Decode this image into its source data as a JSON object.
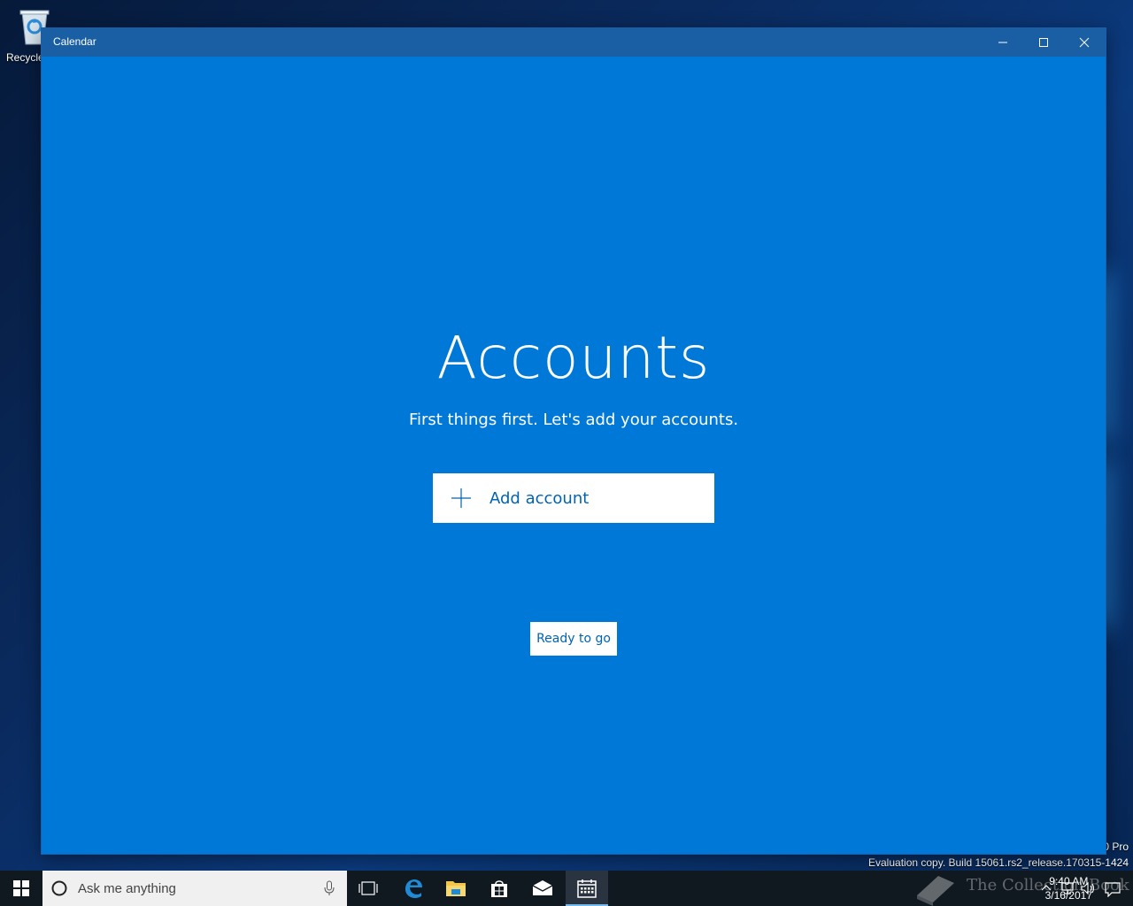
{
  "desktop": {
    "recycle_bin_label": "Recycle",
    "watermark": {
      "line1": "0 Pro",
      "line2": "Evaluation copy. Build 15061.rs2_release.170315-1424"
    }
  },
  "window": {
    "title": "Calendar",
    "controls": [
      "minimize",
      "maximize",
      "close"
    ]
  },
  "accounts_page": {
    "heading": "Accounts",
    "subtitle": "First things first. Let's add your accounts.",
    "add_account_label": "Add account",
    "ready_button_label": "Ready to go"
  },
  "taskbar": {
    "search_placeholder": "Ask me anything",
    "pinned": [
      "task-view-icon",
      "edge-icon",
      "file-explorer-icon",
      "store-icon",
      "mail-icon",
      "calendar-icon"
    ],
    "active_app": "calendar-icon",
    "clock": {
      "time": "9:40 AM",
      "date": "3/16/2017"
    },
    "watermark_text": "The Collection Book"
  },
  "colors": {
    "app_accent": "#0078d7",
    "title_bar": "#1a5ea3",
    "button_text": "#0063b1",
    "taskbar": "#101820"
  }
}
